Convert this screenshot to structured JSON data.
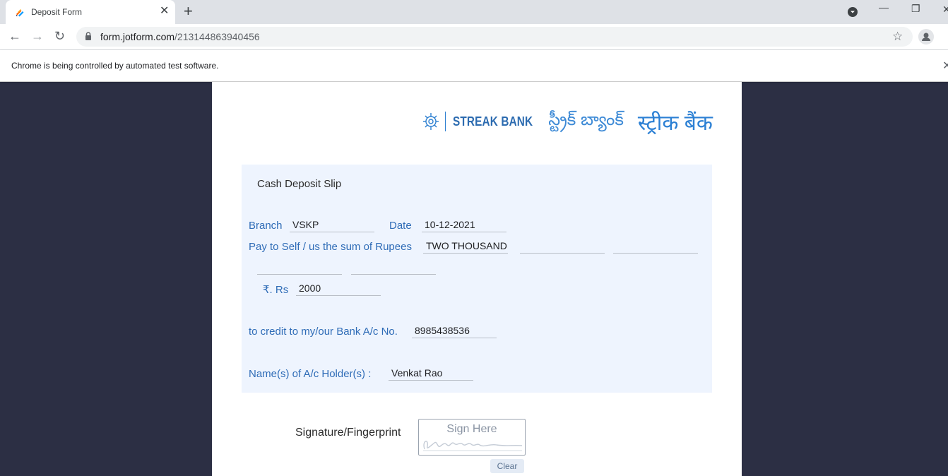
{
  "browser": {
    "tab_title": "Deposit Form",
    "tab_close": "✕",
    "new_tab": "+",
    "url_host": "form.jotform.com",
    "url_path": "/213144863940456",
    "infobar_text": "Chrome is being controlled by automated test software.",
    "infobar_close": "✕",
    "back": "←",
    "forward": "→",
    "reload": "↻",
    "star": "☆",
    "minimize": "—",
    "restore": "❐",
    "close": "✕"
  },
  "logo": {
    "english": "STREAK BANK",
    "telugu": "స్ట్రీక్ బ్యాంక్",
    "hindi": "स्ट्रीक बैंक"
  },
  "slip": {
    "title": "Cash Deposit Slip",
    "branch_label": "Branch",
    "branch_value": "VSKP",
    "date_label": "Date",
    "date_value": "10-12-2021",
    "pay_label": "Pay to Self / us the sum of Rupees",
    "amount_words_value": "TWO THOUSAND",
    "rs_label": "₹. Rs",
    "rs_value": "2000",
    "account_label": "to credit to my/our Bank A/c No.",
    "account_value": "8985438536",
    "holder_label": "Name(s) of A/c Holder(s) :",
    "holder_value": "Venkat Rao"
  },
  "signature": {
    "label": "Signature/Fingerprint",
    "placeholder": "Sign Here",
    "clear": "Clear"
  },
  "colors": {
    "accent": "#2f6cb7",
    "slip_bg": "#eef4fe",
    "page_bg": "#2c2f44"
  }
}
